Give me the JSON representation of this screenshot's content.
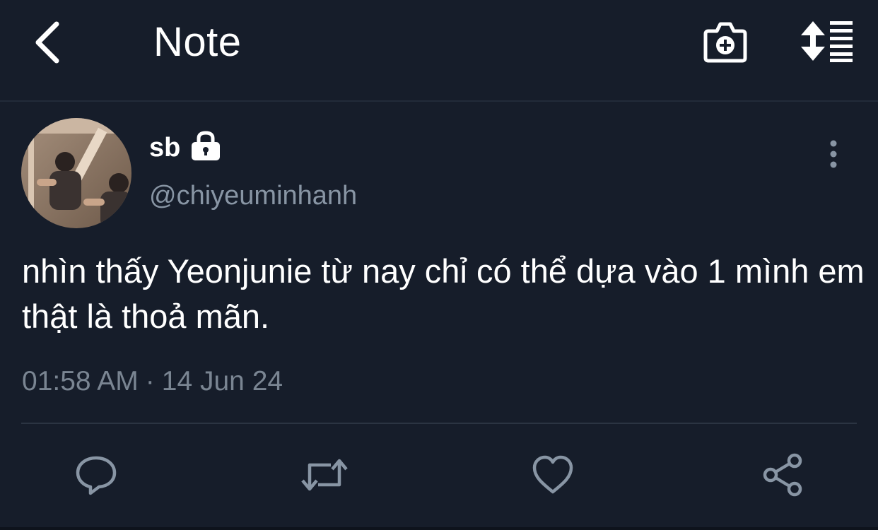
{
  "header": {
    "title": "Note",
    "back_icon": "chevron-left-icon",
    "camera_icon": "camera-add-icon",
    "sort_icon": "sort-list-icon"
  },
  "tweet": {
    "display_name": "sb",
    "lock_icon": "lock-icon",
    "handle": "@chiyeuminhanh",
    "text": "nhìn thấy Yeonjunie từ nay chỉ có thể dựa vào 1 mình em thật là thoả mãn.",
    "time": "01:58 AM",
    "separator": "·",
    "date": "14 Jun 24"
  },
  "actions": [
    "comment-icon",
    "retweet-icon",
    "heart-icon",
    "share-icon"
  ],
  "colors": {
    "background": "#161d2a",
    "text_primary": "#ffffff",
    "text_secondary": "#8895a4",
    "divider": "#2b3442"
  }
}
